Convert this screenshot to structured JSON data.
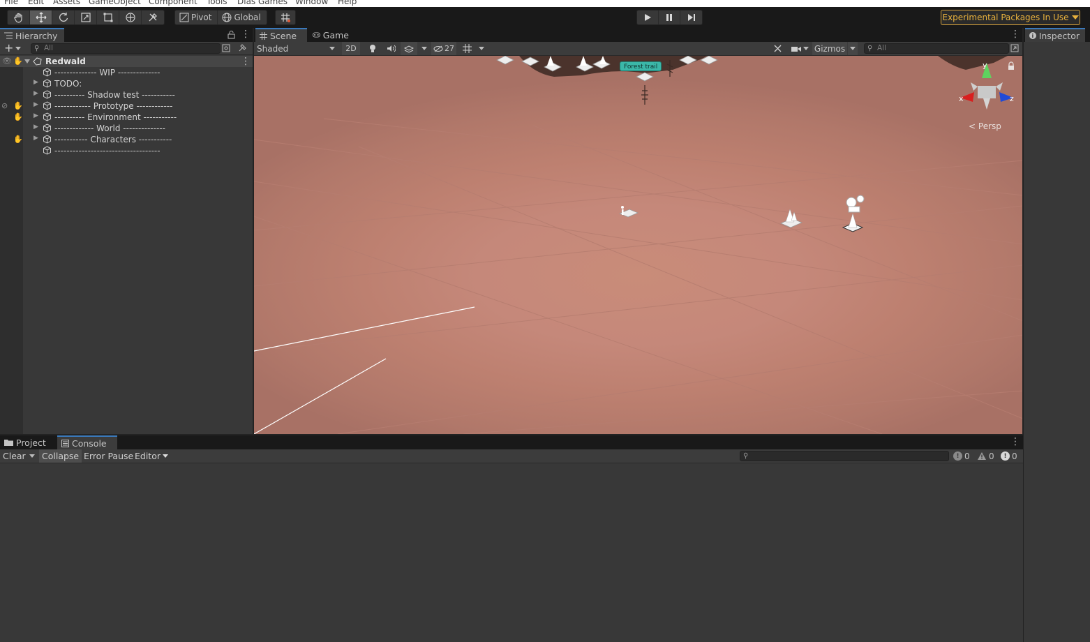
{
  "menu": [
    "File",
    "Edit",
    "Assets",
    "GameObject",
    "Component",
    "Tools",
    "Dias Games",
    "Window",
    "Help"
  ],
  "toolbar": {
    "tools": [
      "hand-tool",
      "move-tool",
      "rotate-tool",
      "scale-tool",
      "rect-tool",
      "transform-tool",
      "custom-tool"
    ],
    "active_tool": "move-tool",
    "pivot_label": "Pivot",
    "global_label": "Global",
    "experimental_label": "Experimental Packages In Use"
  },
  "hierarchy": {
    "tab_label": "Hierarchy",
    "search_placeholder": "All",
    "scene_name": "Redwald",
    "items": [
      {
        "label": "-------------- WIP --------------",
        "expandable": false
      },
      {
        "label": "TODO:",
        "expandable": true
      },
      {
        "label": "---------- Shadow test -----------",
        "expandable": true
      },
      {
        "label": "------------ Prototype ------------",
        "expandable": true
      },
      {
        "label": "---------- Environment -----------",
        "expandable": true
      },
      {
        "label": "------------- World --------------",
        "expandable": true
      },
      {
        "label": "----------- Characters -----------",
        "expandable": true
      },
      {
        "label": "-----------------------------------",
        "expandable": false
      }
    ]
  },
  "scene": {
    "tabs": [
      {
        "label": "Scene"
      },
      {
        "label": "Game"
      }
    ],
    "shading_mode": "Shaded",
    "mode_2d_label": "2D",
    "hidden_count": "27",
    "gizmos_label": "Gizmos",
    "search_placeholder": "All",
    "projection_label": "Persp",
    "location_label": "Forest trail",
    "axes": {
      "x": "x",
      "y": "y",
      "z": "z"
    }
  },
  "inspector": {
    "tab_label": "Inspector"
  },
  "console": {
    "tabs": [
      {
        "label": "Project"
      },
      {
        "label": "Console"
      }
    ],
    "clear_label": "Clear",
    "collapse_label": "Collapse",
    "error_pause_label": "Error Pause",
    "editor_label": "Editor",
    "log_count": "0",
    "warning_count": "0",
    "error_count": "0"
  },
  "colors": {
    "accent": "#3a79bb",
    "experimental": "#e8b13d",
    "ground": "#c5887a",
    "location_badge": "#3bb7a8"
  }
}
